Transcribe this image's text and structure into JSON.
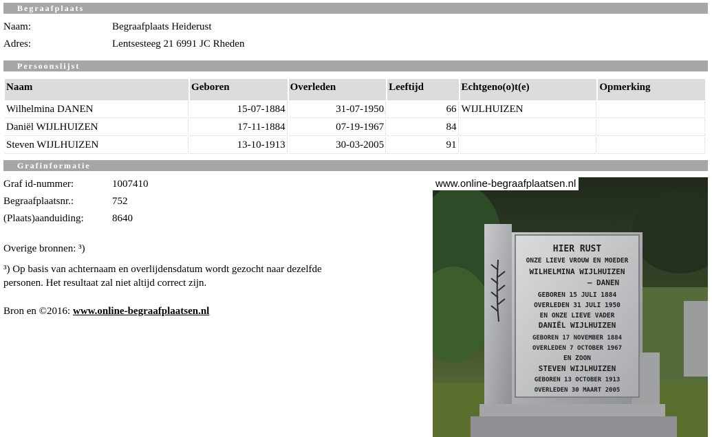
{
  "begraafplaats": {
    "section_title": "Begraafplaats",
    "naam_label": "Naam:",
    "naam_value": "Begraafplaats Heiderust",
    "adres_label": "Adres:",
    "adres_value": "Lentsesteeg 21 6991 JC Rheden"
  },
  "persoonslijst": {
    "section_title": "Persoonslijst",
    "columns": [
      "Naam",
      "Geboren",
      "Overleden",
      "Leeftijd",
      "Echtgeno(o)t(e)",
      "Opmerking"
    ],
    "rows": [
      {
        "naam": "Wilhelmina DANEN",
        "geboren": "15-07-1884",
        "overleden": "31-07-1950",
        "leeftijd": "66",
        "echtgenoot": "WIJLHUIZEN",
        "opmerking": ""
      },
      {
        "naam": "Daniël WIJLHUIZEN",
        "geboren": "17-11-1884",
        "overleden": "07-19-1967",
        "leeftijd": "84",
        "echtgenoot": "",
        "opmerking": ""
      },
      {
        "naam": "Steven WIJLHUIZEN",
        "geboren": "13-10-1913",
        "overleden": "30-03-2005",
        "leeftijd": "91",
        "echtgenoot": "",
        "opmerking": ""
      }
    ]
  },
  "grafinformatie": {
    "section_title": "Grafinformatie",
    "graf_id_label": "Graf id-nummer:",
    "graf_id_value": "1007410",
    "begraafplaatsnr_label": "Begraafplaatsnr.:",
    "begraafplaatsnr_value": "752",
    "aanduiding_label": "(Plaats)aanduiding:",
    "aanduiding_value": "8640",
    "overige_bronnen": "Overige bronnen: ³)",
    "footnote": "³) Op basis van achternaam en overlijdensdatum wordt gezocht naar dezelfde personen. Het resultaat zal niet altijd correct zijn.",
    "bron_label": "Bron en ©2016:",
    "bron_link": "www.online-begraafplaatsen.nl"
  },
  "photo": {
    "caption": "www.online-begraafplaatsen.nl",
    "stone_lines": [
      "HIER RUST",
      "ONZE LIEVE VROUW EN MOEDER",
      "WILHELMINA WIJLHUIZEN",
      "— DANEN",
      "GEBOREN 15 JULI 1884",
      "OVERLEDEN 31 JULI 1950",
      "EN ONZE LIEVE VADER",
      "DANIËL WIJLHUIZEN",
      "GEBOREN 17 NOVEMBER 1884",
      "OVERLEDEN 7 OCTOBER 1967",
      "EN ZOON",
      "STEVEN WIJLHUIZEN",
      "GEBOREN 13 OCTOBER 1913",
      "OVERLEDEN 30 MAART 2005"
    ]
  }
}
